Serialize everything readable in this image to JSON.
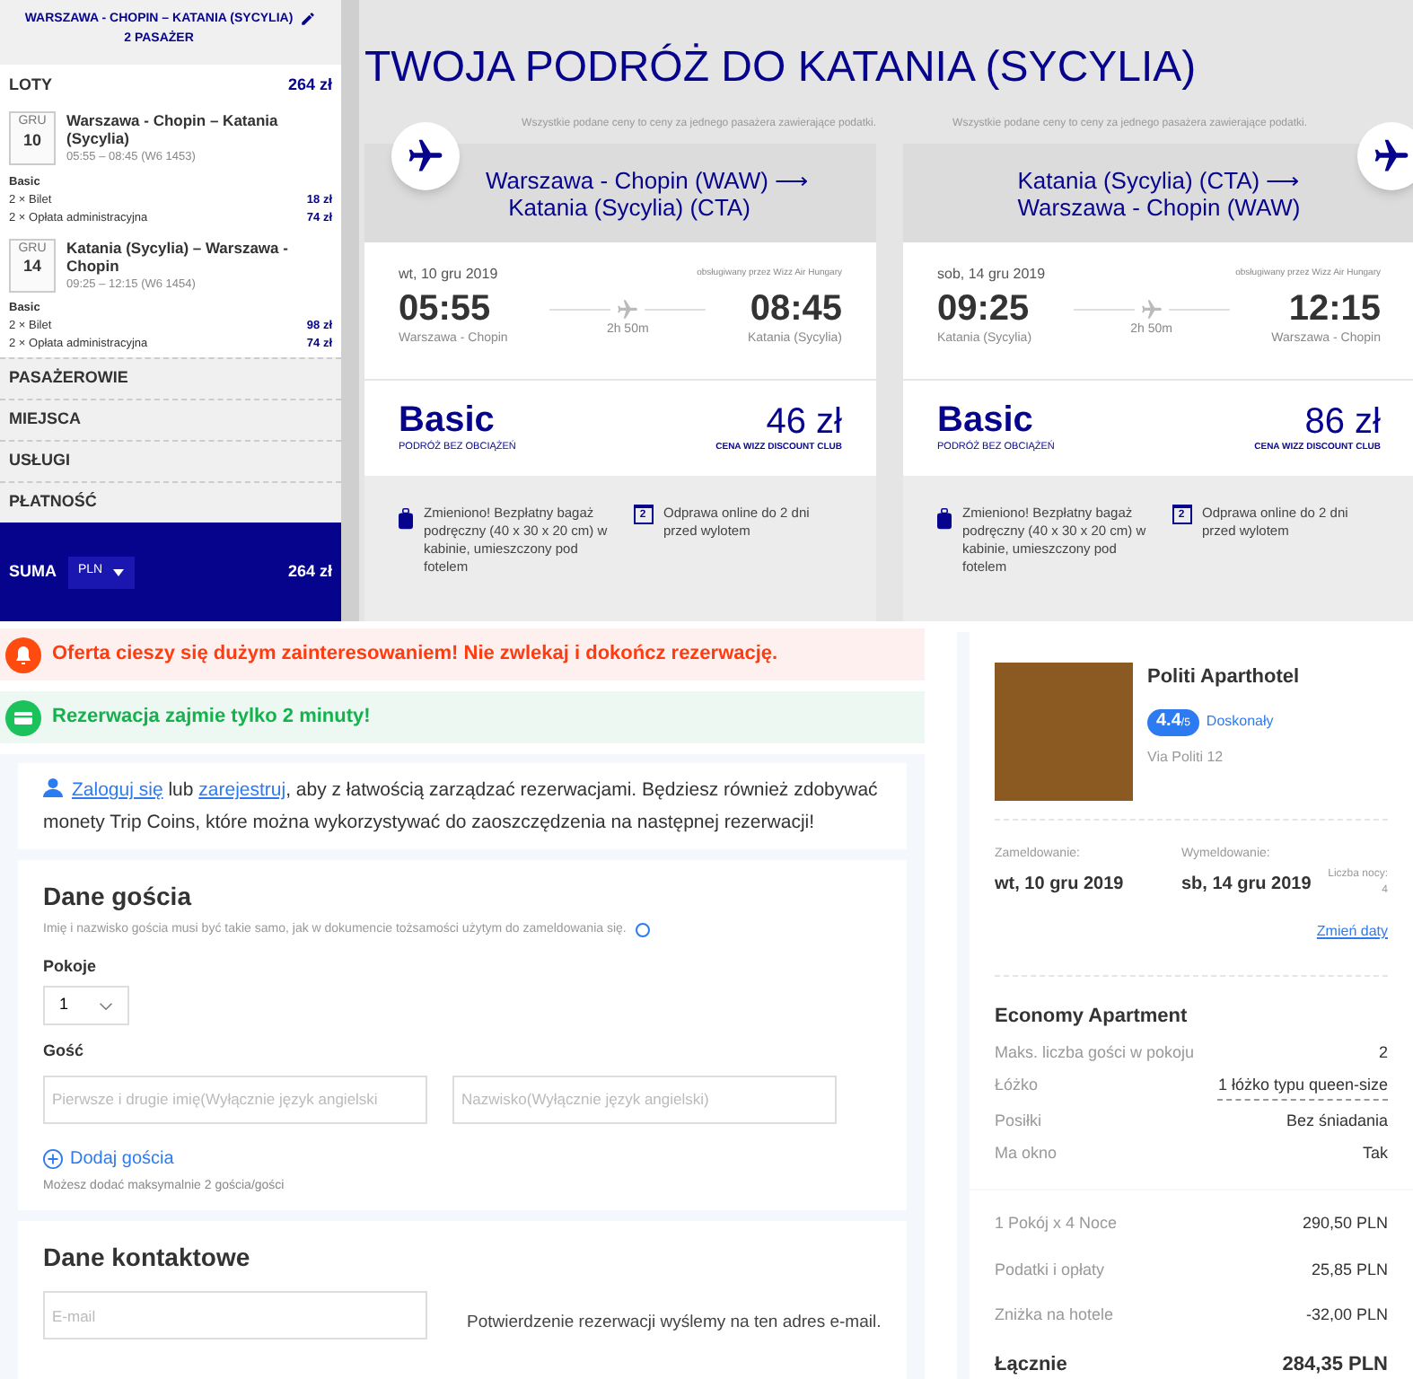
{
  "sidebar": {
    "route": "WARSZAWA - CHOPIN – KATANIA (SYCYLIA)",
    "passengers": "2 PASAŻER",
    "flights_title": "LOTY",
    "flights_total": "264 zł",
    "flights": [
      {
        "month": "GRU",
        "day": "10",
        "route": "Warszawa - Chopin – Katania (Sycylia)",
        "times": "05:55 – 08:45 (W6 1453)",
        "fare": "Basic",
        "lines": [
          {
            "label": "2 × Bilet",
            "price": "18 zł"
          },
          {
            "label": "2 × Opłata administracyjna",
            "price": "74 zł"
          }
        ]
      },
      {
        "month": "GRU",
        "day": "14",
        "route": "Katania (Sycylia) – Warszawa - Chopin",
        "times": "09:25 – 12:15 (W6 1454)",
        "fare": "Basic",
        "lines": [
          {
            "label": "2 × Bilet",
            "price": "98 zł"
          },
          {
            "label": "2 × Opłata administracyjna",
            "price": "74 zł"
          }
        ]
      }
    ],
    "sections": [
      "PASAŻEROWIE",
      "MIEJSCA",
      "USŁUGI",
      "PŁATNOŚĆ"
    ],
    "summary": {
      "label": "SUMA",
      "currency": "PLN",
      "total": "264 zł"
    }
  },
  "title": "TWOJA PODRÓŻ DO KATANIA (SYCYLIA)",
  "cards": [
    {
      "note": "Wszystkie podane ceny to ceny za jednego pasażera zawierające podatki.",
      "route_from": "Warszawa - Chopin (WAW)",
      "arrow": "⟶",
      "route_to": "Katania (Sycylia) (CTA)",
      "date": "wt, 10 gru 2019",
      "operator": "obsługiwany przez Wizz Air Hungary",
      "dep_time": "05:55",
      "dep_city": "Warszawa - Chopin",
      "duration": "2h 50m",
      "arr_time": "08:45",
      "arr_city": "Katania (Sycylia)",
      "fare": "Basic",
      "fare_sub": "PODRÓŻ BEZ OBCIĄŻEŃ",
      "price": "46 zł",
      "price_sub": "CENA WIZZ DISCOUNT CLUB",
      "features": [
        {
          "kind": "bag",
          "text": "Zmieniono! Bezpłatny bagaż podręczny (40 x 30 x 20 cm) w kabinie, umieszczony pod fotelem"
        },
        {
          "kind": "calendar",
          "icon_text": "2",
          "text": "Odprawa online do 2 dni przed wylotem"
        }
      ]
    },
    {
      "note": "Wszystkie podane ceny to ceny za jednego pasażera zawierające podatki.",
      "route_from": "Katania (Sycylia) (CTA)",
      "arrow": "⟶",
      "route_to": "Warszawa - Chopin (WAW)",
      "date": "sob, 14 gru 2019",
      "operator": "obsługiwany przez Wizz Air Hungary",
      "dep_time": "09:25",
      "dep_city": "Katania (Sycylia)",
      "duration": "2h 50m",
      "arr_time": "12:15",
      "arr_city": "Warszawa - Chopin",
      "fare": "Basic",
      "fare_sub": "PODRÓŻ BEZ OBCIĄŻEŃ",
      "price": "86 zł",
      "price_sub": "CENA WIZZ DISCOUNT CLUB",
      "features": [
        {
          "kind": "bag",
          "text": "Zmieniono! Bezpłatny bagaż podręczny (40 x 30 x 20 cm) w kabinie, umieszczony pod fotelem"
        },
        {
          "kind": "calendar",
          "icon_text": "2",
          "text": "Odprawa online do 2 dni przed wylotem"
        }
      ]
    }
  ],
  "alerts": [
    {
      "kind": "warning",
      "text": "Oferta cieszy się dużym zainteresowaniem! Nie zwlekaj i dokończ rezerwację."
    },
    {
      "kind": "success",
      "text": "Rezerwacja zajmie tylko 2 minuty!"
    }
  ],
  "login": {
    "login_link": "Zaloguj się",
    "or": "lub",
    "register_link": "zarejestruj",
    "rest": ", aby z łatwością zarządzać rezerwacjami. Będziesz również zdobywać monety Trip Coins, które można wykorzystywać do zaoszczędzenia na następnej rezerwacji!"
  },
  "guest": {
    "title": "Dane gościa",
    "note": "Imię i nazwisko gościa musi być takie samo, jak w dokumencie tożsamości użytym do zameldowania się.",
    "rooms_label": "Pokoje",
    "rooms_value": "1",
    "guest_label": "Gość",
    "first_name_placeholder": "Pierwsze i drugie imię(Wyłącznie język angielski",
    "last_name_placeholder": "Nazwisko(Wyłącznie język angielski)",
    "add_guest": "Dodaj gościa",
    "add_note": "Możesz dodać maksymalnie 2 gościa/gości"
  },
  "contact": {
    "title": "Dane kontaktowe",
    "email_placeholder": "E-mail",
    "email_note": "Potwierdzenie rezerwacji wyślemy na ten adres e-mail."
  },
  "hotel": {
    "name": "Politi Aparthotel",
    "rating": "4.4",
    "rating_scale": "/5",
    "rating_label": "Doskonały",
    "address": "Via Politi 12",
    "checkin_label": "Zameldowanie:",
    "checkin": "wt, 10 gru 2019",
    "checkout_label": "Wymeldowanie:",
    "checkout": "sb, 14 gru 2019",
    "nights_label": "Liczba nocy:",
    "nights": "4",
    "change_dates": "Zmień daty",
    "room_name": "Economy Apartment",
    "details": [
      {
        "kind": "plain",
        "label": "Maks. liczba gości w pokoju",
        "value": "2"
      },
      {
        "kind": "link",
        "label": "Łóżko",
        "value": "1 łóżko typu queen-size"
      },
      {
        "kind": "plain",
        "label": "Posiłki",
        "value": "Bez śniadania"
      },
      {
        "kind": "plain",
        "label": "Ma okno",
        "value": "Tak"
      }
    ],
    "prices": [
      {
        "label": "1 Pokój x 4 Noce",
        "value": "290,50 PLN"
      },
      {
        "label": "Podatki i opłaty",
        "value": "25,85 PLN"
      },
      {
        "label": "Zniżka na hotele",
        "value": "-32,00 PLN"
      }
    ],
    "total": {
      "label": "Łącznie",
      "value": "284,35 PLN"
    }
  }
}
